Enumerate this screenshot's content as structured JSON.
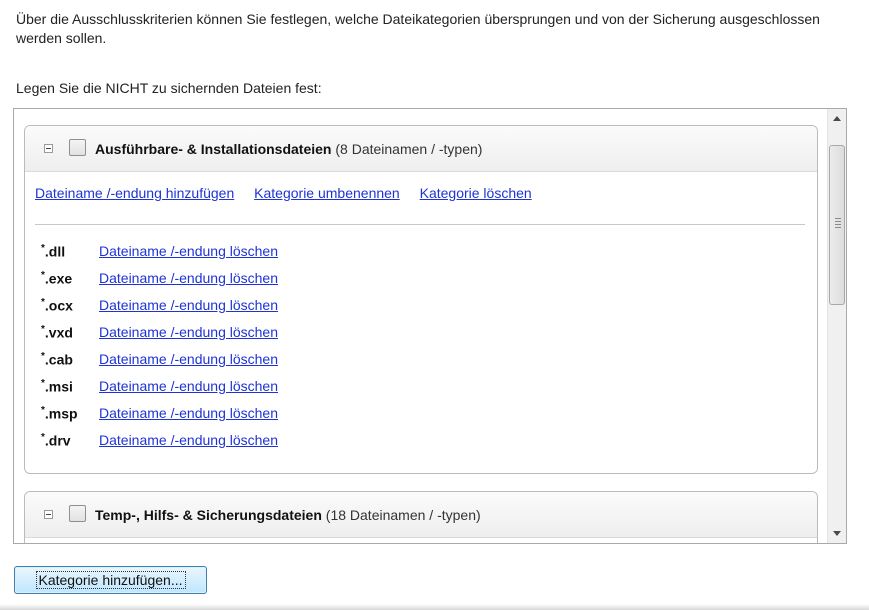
{
  "intro_text": "Über die Ausschlusskriterien können Sie festlegen, welche Dateikategorien übersprungen und von der Sicherung ausgeschlossen werden sollen.",
  "prompt_text": "Legen Sie die NICHT zu sichernden Dateien fest:",
  "groups": [
    {
      "title": "Ausführbare- & Installationsdateien",
      "count": "(8 Dateinamen / -typen)",
      "checked": false,
      "expanded": true,
      "actions": {
        "add": "Dateiname /-endung hinzufügen",
        "rename": "Kategorie umbenennen",
        "delete": "Kategorie löschen"
      },
      "files": [
        {
          "ext": ".dll",
          "action": "Dateiname /-endung löschen"
        },
        {
          "ext": ".exe",
          "action": "Dateiname /-endung löschen"
        },
        {
          "ext": ".ocx",
          "action": "Dateiname /-endung löschen"
        },
        {
          "ext": ".vxd",
          "action": "Dateiname /-endung löschen"
        },
        {
          "ext": ".cab",
          "action": "Dateiname /-endung löschen"
        },
        {
          "ext": ".msi",
          "action": "Dateiname /-endung löschen"
        },
        {
          "ext": ".msp",
          "action": "Dateiname /-endung löschen"
        },
        {
          "ext": ".drv",
          "action": "Dateiname /-endung löschen"
        }
      ]
    },
    {
      "title": "Temp-, Hilfs- & Sicherungsdateien",
      "count": "(18 Dateinamen / -typen)",
      "checked": false,
      "expanded": true
    }
  ],
  "add_category_button": "Kategorie hinzufügen...",
  "colors": {
    "link": "#1d33d6",
    "button_border": "#3c7fb1",
    "button_fill": "#bee6fd"
  }
}
